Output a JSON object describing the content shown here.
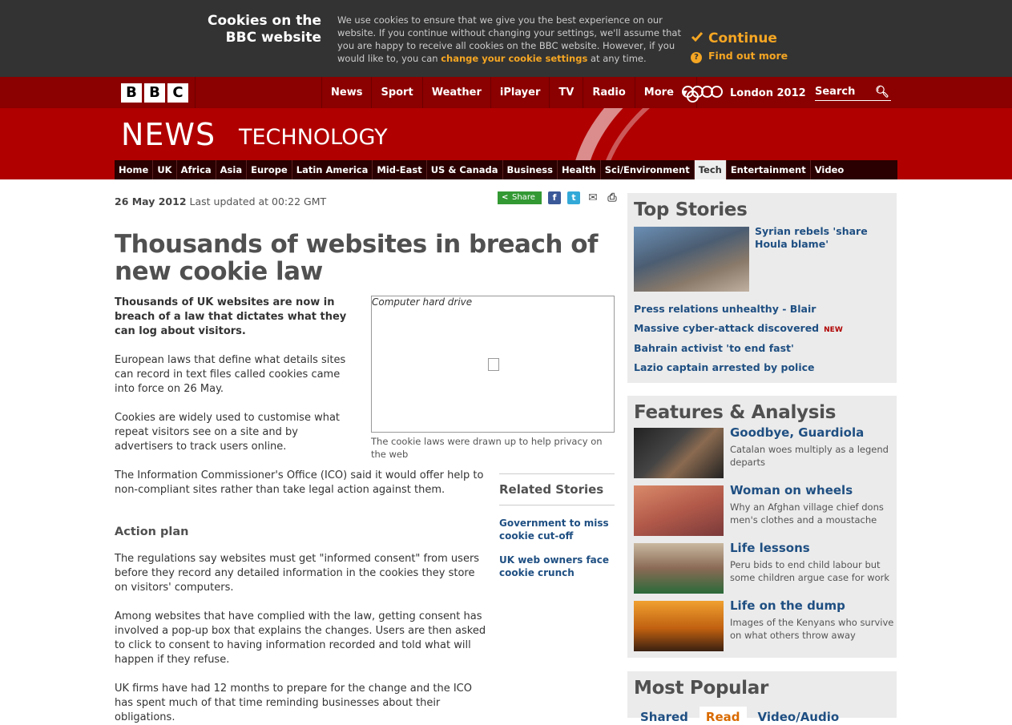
{
  "cookie_banner": {
    "title_line1": "Cookies on the",
    "title_line2": "BBC website",
    "text_before": "We use cookies to ensure that we give you the best experience on our website. If you continue without changing your settings, we'll assume that you are happy to receive all cookies on the BBC website. However, if you would like to, you can",
    "link": "change your cookie settings",
    "text_after": "at any time.",
    "continue_label": "Continue",
    "find_out_label": "Find out more"
  },
  "masthead": {
    "logo_letters": [
      "B",
      "B",
      "C"
    ],
    "nav": [
      "News",
      "Sport",
      "Weather",
      "iPlayer",
      "TV",
      "Radio",
      "More"
    ],
    "olympics_label": "London 2012",
    "search_placeholder": "Search",
    "news_word": "NEWS",
    "section_word": "TECHNOLOGY",
    "subnav": [
      "Home",
      "UK",
      "Africa",
      "Asia",
      "Europe",
      "Latin America",
      "Mid-East",
      "US & Canada",
      "Business",
      "Health",
      "Sci/Environment",
      "Tech",
      "Entertainment",
      "Video"
    ],
    "active_subnav": "Tech"
  },
  "article": {
    "date": "26 May 2012",
    "updated": "Last updated at 00:22 GMT",
    "share_label": "Share",
    "title": "Thousands of websites in breach of new cookie law",
    "intro": "Thousands of UK websites are now in breach of a law that dictates what they can log about visitors.",
    "p1": "European laws that define what details sites can record in text files called cookies came into force on 26 May.",
    "p2": "Cookies are widely used to customise what repeat visitors see on a site and by advertisers to track users online.",
    "p3": "The Information Commissioner's Office (ICO) said it would offer help to non-compliant sites rather than take legal action against them.",
    "subhead": "Action plan",
    "p4": "The regulations say websites must get \"informed consent\" from users before they record any detailed information in the cookies they store on visitors' computers.",
    "p5": "Among websites that have complied with the law, getting consent has involved a pop-up box that explains the changes. Users are then asked to click to consent to having information recorded and told what will happen if they refuse.",
    "p6": "UK firms have had 12 months to prepare for the change and the ICO has spent much of that time reminding businesses about their obligations.",
    "image_alt": "Computer hard drive",
    "image_caption": "The cookie laws were drawn up to help privacy on the web"
  },
  "related": {
    "heading": "Related Stories",
    "links": [
      "Government to miss cookie cut-off",
      "UK web owners face cookie crunch"
    ]
  },
  "top_stories": {
    "heading": "Top Stories",
    "lead": "Syrian rebels 'share Houla blame'",
    "links": [
      "Press relations unhealthy - Blair",
      "Massive cyber-attack discovered",
      "Bahrain activist 'to end fast'",
      "Lazio captain arrested by police"
    ],
    "new_badge": "NEW"
  },
  "features": {
    "heading": "Features & Analysis",
    "items": [
      {
        "title": "Goodbye, Guardiola",
        "desc": "Catalan woes multiply as a legend departs"
      },
      {
        "title": "Woman on wheels",
        "desc": "Why an Afghan village chief dons men's clothes and a moustache"
      },
      {
        "title": "Life lessons",
        "desc": "Peru bids to end child labour but some children argue case for work"
      },
      {
        "title": "Life on the dump",
        "desc": "Images of the Kenyans who survive on what others throw away"
      }
    ]
  },
  "most_popular": {
    "heading": "Most Popular",
    "tabs": [
      "Shared",
      "Read",
      "Video/Audio"
    ],
    "selected_tab": "Read"
  }
}
